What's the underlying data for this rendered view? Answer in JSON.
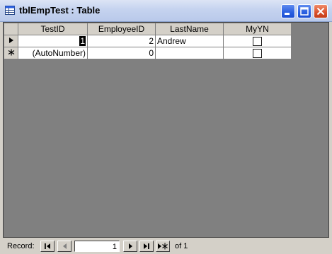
{
  "window": {
    "title": "tblEmpTest : Table"
  },
  "columns": [
    "TestID",
    "EmployeeID",
    "LastName",
    "MyYN"
  ],
  "rows": [
    {
      "selector": "current-record-icon",
      "testid": "1",
      "employeeid": "2",
      "lastname": "Andrew",
      "myyn": false
    },
    {
      "selector": "new-record-icon",
      "testid": "(AutoNumber)",
      "employeeid": "0",
      "lastname": "",
      "myyn": false
    }
  ],
  "navigation": {
    "label": "Record:",
    "current": "1",
    "of_text": "of 1"
  },
  "colors": {
    "grid_background": "#808080",
    "chrome": "#d4d0c8",
    "title_gradient": "#c5d3ef",
    "close_button": "#d8502c"
  }
}
